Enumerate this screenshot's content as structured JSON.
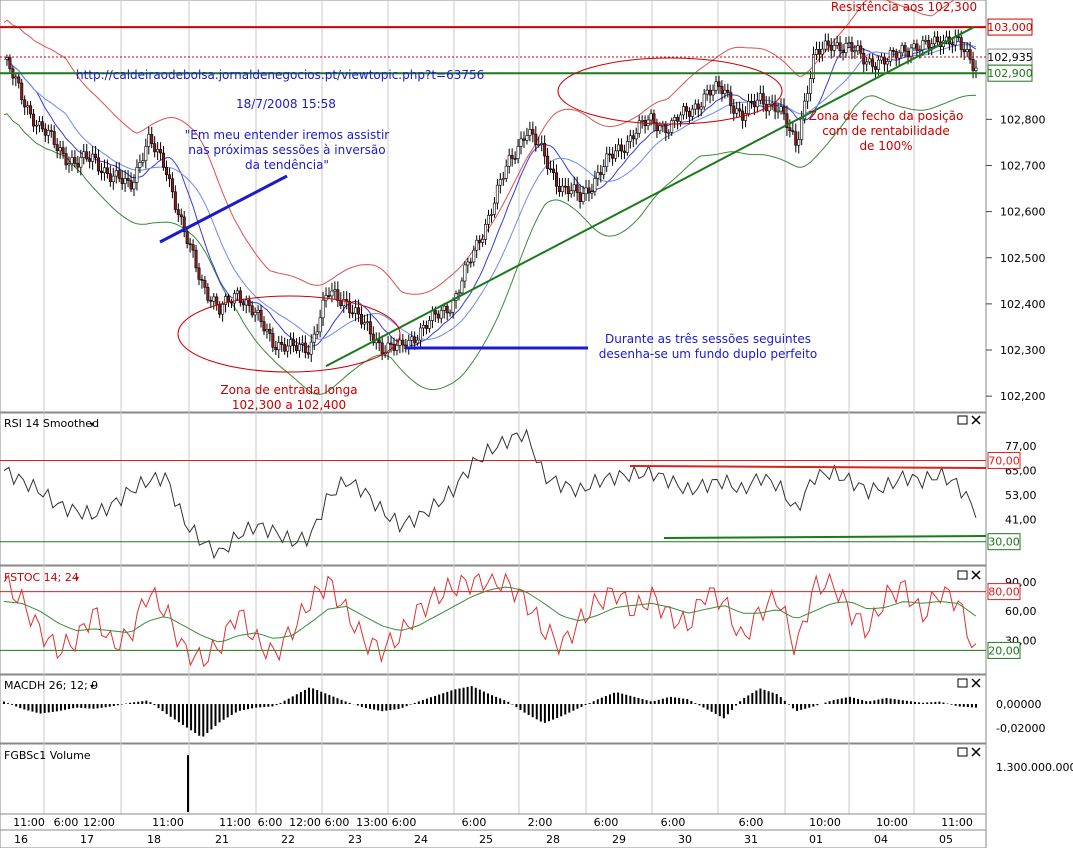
{
  "chart_data": [
    {
      "panel": "price",
      "type": "candlestick",
      "symbol": "FGBSc1",
      "ylim": [
        102.17,
        103.05
      ],
      "y_ticks": [
        "102,200",
        "102,300",
        "102,400",
        "102,500",
        "102,600",
        "102,700",
        "102,800"
      ],
      "price_path": [
        102.93,
        102.85,
        102.78,
        102.74,
        102.7,
        102.72,
        102.67,
        102.66,
        102.75,
        102.7,
        102.55,
        102.45,
        102.38,
        102.43,
        102.37,
        102.32,
        102.3,
        102.31,
        102.42,
        102.41,
        102.35,
        102.31,
        102.3,
        102.34,
        102.37,
        102.41,
        102.5,
        102.6,
        102.7,
        102.78,
        102.72,
        102.65,
        102.63,
        102.68,
        102.73,
        102.77,
        102.8,
        102.78,
        102.82,
        102.85,
        102.87,
        102.8,
        102.85,
        102.82,
        102.75,
        102.93,
        102.97,
        102.95,
        102.93,
        102.92,
        102.96,
        102.95,
        102.98,
        102.96,
        102.92
      ],
      "moving_average_colors": [
        "#3a3ad8",
        "#6b8cf0"
      ],
      "bollinger_upper_color": "#e05050",
      "bollinger_lower_color": "#3a8a3a",
      "horizontal_levels": [
        {
          "value": 103.0,
          "label": "103,000",
          "color": "#cc0000"
        },
        {
          "value": 102.935,
          "label": "102,935",
          "color": "#cc0000"
        },
        {
          "value": 102.9,
          "label": "102,900",
          "color": "#1a7a1a"
        }
      ],
      "trendline": {
        "from": [
          "23",
          102.265
        ],
        "to": [
          "05",
          103.0
        ],
        "color": "#1a7a1a"
      },
      "annotations": {
        "url": "http://caldeiraodebolsa.jornaldenegocios.pt/viewtopic.php?t=63756",
        "date": "18/7/2008 15:58",
        "quote": [
          "\"Em meu entender iremos assistir",
          "nas próximas sessões à inversão",
          "da tendência\""
        ],
        "double_bottom": [
          "Durante as três sessões seguintes",
          "desenha-se um fundo duplo perfeito"
        ],
        "entry_zone": [
          "Zona de entrada longa",
          "102,300 a 102,400"
        ],
        "exit_zone": [
          "Zona de fecho da posição",
          "com de rentabilidade",
          "de 100%"
        ],
        "resistance": "Resistência aos 102,300"
      }
    },
    {
      "panel": "rsi",
      "type": "line",
      "title": "RSI 14 Smoothed",
      "y_ticks": [
        "77,00",
        "65,00",
        "53,00",
        "41,00"
      ],
      "levels": [
        {
          "value": 70,
          "label": "70,00"
        },
        {
          "value": 30,
          "label": "30,00"
        }
      ],
      "ylim": [
        20,
        85
      ],
      "values": [
        65,
        60,
        55,
        48,
        45,
        43,
        48,
        55,
        60,
        62,
        40,
        30,
        24,
        33,
        38,
        35,
        30,
        32,
        52,
        60,
        55,
        45,
        38,
        42,
        48,
        56,
        68,
        75,
        80,
        84,
        62,
        58,
        55,
        60,
        62,
        63,
        64,
        60,
        55,
        58,
        60,
        55,
        62,
        58,
        45,
        62,
        64,
        60,
        55,
        57,
        62,
        60,
        63,
        58,
        45
      ]
    },
    {
      "panel": "stochastic",
      "type": "line",
      "title": "FSTOC 14; 24",
      "y_ticks": [
        "90,00",
        "60,00",
        "30,00"
      ],
      "levels": [
        {
          "value": 80,
          "label": "80,00"
        },
        {
          "value": 20,
          "label": "20,00"
        }
      ],
      "ylim": [
        0,
        100
      ],
      "series": [
        {
          "color": "#e03030",
          "values": [
            90,
            70,
            40,
            20,
            30,
            60,
            25,
            35,
            80,
            60,
            20,
            10,
            25,
            60,
            30,
            15,
            40,
            70,
            90,
            60,
            30,
            20,
            35,
            60,
            75,
            85,
            90,
            92,
            88,
            70,
            40,
            25,
            50,
            70,
            80,
            60,
            75,
            55,
            45,
            80,
            70,
            30,
            60,
            75,
            20,
            85,
            90,
            60,
            40,
            75,
            85,
            55,
            80,
            70,
            15
          ]
        },
        {
          "color": "#3a8a3a",
          "values": [
            70,
            68,
            60,
            48,
            40,
            42,
            40,
            38,
            50,
            55,
            45,
            35,
            28,
            35,
            38,
            32,
            35,
            48,
            62,
            65,
            55,
            45,
            40,
            45,
            55,
            65,
            75,
            82,
            85,
            80,
            68,
            55,
            50,
            56,
            64,
            66,
            68,
            64,
            58,
            62,
            66,
            58,
            58,
            62,
            52,
            60,
            68,
            70,
            62,
            64,
            70,
            68,
            70,
            68,
            55
          ]
        }
      ]
    },
    {
      "panel": "macd_histogram",
      "type": "bar",
      "title": "MACDH 26; 12; 9",
      "y_ticks": [
        "0,00000",
        "-0,02000"
      ],
      "ylim": [
        -0.03,
        0.02
      ],
      "values": [
        0.002,
        -0.004,
        -0.008,
        -0.006,
        -0.003,
        -0.004,
        -0.002,
        0.001,
        0.003,
        -0.008,
        -0.018,
        -0.028,
        -0.015,
        -0.006,
        -0.003,
        -0.002,
        0.006,
        0.014,
        0.008,
        0.002,
        -0.003,
        -0.006,
        -0.004,
        0.002,
        0.007,
        0.012,
        0.015,
        0.008,
        0.002,
        -0.008,
        -0.016,
        -0.01,
        -0.003,
        0.004,
        0.01,
        0.006,
        0.002,
        0.006,
        0.004,
        -0.004,
        -0.012,
        0.004,
        0.013,
        0.008,
        -0.006,
        -0.002,
        0.003,
        0.006,
        0.002,
        0.005,
        0.003,
        0.001,
        0.002,
        -0.002,
        -0.003
      ]
    },
    {
      "panel": "volume",
      "type": "bar",
      "title": "FGBSc1 Volume",
      "y_ticks": [
        "1.300.000.000"
      ],
      "spike_label": "18",
      "spike_value": 1650000000
    }
  ],
  "x_axis": {
    "time_labels": [
      "11:00",
      "6:00",
      "12:00",
      "11:00",
      "11:00",
      "6:00",
      "12:00",
      "6:00",
      "13:00",
      "6:00",
      "6:00",
      "2:00",
      "6:00",
      "6:00",
      "6:00",
      "10:00",
      "10:00",
      "11:00"
    ],
    "day_labels": [
      "16",
      "17",
      "18",
      "21",
      "22",
      "23",
      "24",
      "25",
      "28",
      "29",
      "30",
      "31",
      "01",
      "04",
      "05"
    ]
  }
}
